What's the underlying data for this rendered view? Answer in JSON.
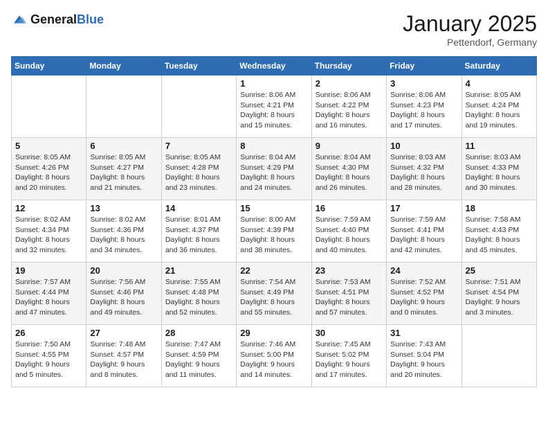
{
  "header": {
    "logo_general": "General",
    "logo_blue": "Blue",
    "month_title": "January 2025",
    "location": "Pettendorf, Germany"
  },
  "weekdays": [
    "Sunday",
    "Monday",
    "Tuesday",
    "Wednesday",
    "Thursday",
    "Friday",
    "Saturday"
  ],
  "weeks": [
    [
      {
        "day": "",
        "detail": ""
      },
      {
        "day": "",
        "detail": ""
      },
      {
        "day": "",
        "detail": ""
      },
      {
        "day": "1",
        "detail": "Sunrise: 8:06 AM\nSunset: 4:21 PM\nDaylight: 8 hours\nand 15 minutes."
      },
      {
        "day": "2",
        "detail": "Sunrise: 8:06 AM\nSunset: 4:22 PM\nDaylight: 8 hours\nand 16 minutes."
      },
      {
        "day": "3",
        "detail": "Sunrise: 8:06 AM\nSunset: 4:23 PM\nDaylight: 8 hours\nand 17 minutes."
      },
      {
        "day": "4",
        "detail": "Sunrise: 8:05 AM\nSunset: 4:24 PM\nDaylight: 8 hours\nand 19 minutes."
      }
    ],
    [
      {
        "day": "5",
        "detail": "Sunrise: 8:05 AM\nSunset: 4:26 PM\nDaylight: 8 hours\nand 20 minutes."
      },
      {
        "day": "6",
        "detail": "Sunrise: 8:05 AM\nSunset: 4:27 PM\nDaylight: 8 hours\nand 21 minutes."
      },
      {
        "day": "7",
        "detail": "Sunrise: 8:05 AM\nSunset: 4:28 PM\nDaylight: 8 hours\nand 23 minutes."
      },
      {
        "day": "8",
        "detail": "Sunrise: 8:04 AM\nSunset: 4:29 PM\nDaylight: 8 hours\nand 24 minutes."
      },
      {
        "day": "9",
        "detail": "Sunrise: 8:04 AM\nSunset: 4:30 PM\nDaylight: 8 hours\nand 26 minutes."
      },
      {
        "day": "10",
        "detail": "Sunrise: 8:03 AM\nSunset: 4:32 PM\nDaylight: 8 hours\nand 28 minutes."
      },
      {
        "day": "11",
        "detail": "Sunrise: 8:03 AM\nSunset: 4:33 PM\nDaylight: 8 hours\nand 30 minutes."
      }
    ],
    [
      {
        "day": "12",
        "detail": "Sunrise: 8:02 AM\nSunset: 4:34 PM\nDaylight: 8 hours\nand 32 minutes."
      },
      {
        "day": "13",
        "detail": "Sunrise: 8:02 AM\nSunset: 4:36 PM\nDaylight: 8 hours\nand 34 minutes."
      },
      {
        "day": "14",
        "detail": "Sunrise: 8:01 AM\nSunset: 4:37 PM\nDaylight: 8 hours\nand 36 minutes."
      },
      {
        "day": "15",
        "detail": "Sunrise: 8:00 AM\nSunset: 4:39 PM\nDaylight: 8 hours\nand 38 minutes."
      },
      {
        "day": "16",
        "detail": "Sunrise: 7:59 AM\nSunset: 4:40 PM\nDaylight: 8 hours\nand 40 minutes."
      },
      {
        "day": "17",
        "detail": "Sunrise: 7:59 AM\nSunset: 4:41 PM\nDaylight: 8 hours\nand 42 minutes."
      },
      {
        "day": "18",
        "detail": "Sunrise: 7:58 AM\nSunset: 4:43 PM\nDaylight: 8 hours\nand 45 minutes."
      }
    ],
    [
      {
        "day": "19",
        "detail": "Sunrise: 7:57 AM\nSunset: 4:44 PM\nDaylight: 8 hours\nand 47 minutes."
      },
      {
        "day": "20",
        "detail": "Sunrise: 7:56 AM\nSunset: 4:46 PM\nDaylight: 8 hours\nand 49 minutes."
      },
      {
        "day": "21",
        "detail": "Sunrise: 7:55 AM\nSunset: 4:48 PM\nDaylight: 8 hours\nand 52 minutes."
      },
      {
        "day": "22",
        "detail": "Sunrise: 7:54 AM\nSunset: 4:49 PM\nDaylight: 8 hours\nand 55 minutes."
      },
      {
        "day": "23",
        "detail": "Sunrise: 7:53 AM\nSunset: 4:51 PM\nDaylight: 8 hours\nand 57 minutes."
      },
      {
        "day": "24",
        "detail": "Sunrise: 7:52 AM\nSunset: 4:52 PM\nDaylight: 9 hours\nand 0 minutes."
      },
      {
        "day": "25",
        "detail": "Sunrise: 7:51 AM\nSunset: 4:54 PM\nDaylight: 9 hours\nand 3 minutes."
      }
    ],
    [
      {
        "day": "26",
        "detail": "Sunrise: 7:50 AM\nSunset: 4:55 PM\nDaylight: 9 hours\nand 5 minutes."
      },
      {
        "day": "27",
        "detail": "Sunrise: 7:48 AM\nSunset: 4:57 PM\nDaylight: 9 hours\nand 8 minutes."
      },
      {
        "day": "28",
        "detail": "Sunrise: 7:47 AM\nSunset: 4:59 PM\nDaylight: 9 hours\nand 11 minutes."
      },
      {
        "day": "29",
        "detail": "Sunrise: 7:46 AM\nSunset: 5:00 PM\nDaylight: 9 hours\nand 14 minutes."
      },
      {
        "day": "30",
        "detail": "Sunrise: 7:45 AM\nSunset: 5:02 PM\nDaylight: 9 hours\nand 17 minutes."
      },
      {
        "day": "31",
        "detail": "Sunrise: 7:43 AM\nSunset: 5:04 PM\nDaylight: 9 hours\nand 20 minutes."
      },
      {
        "day": "",
        "detail": ""
      }
    ]
  ]
}
